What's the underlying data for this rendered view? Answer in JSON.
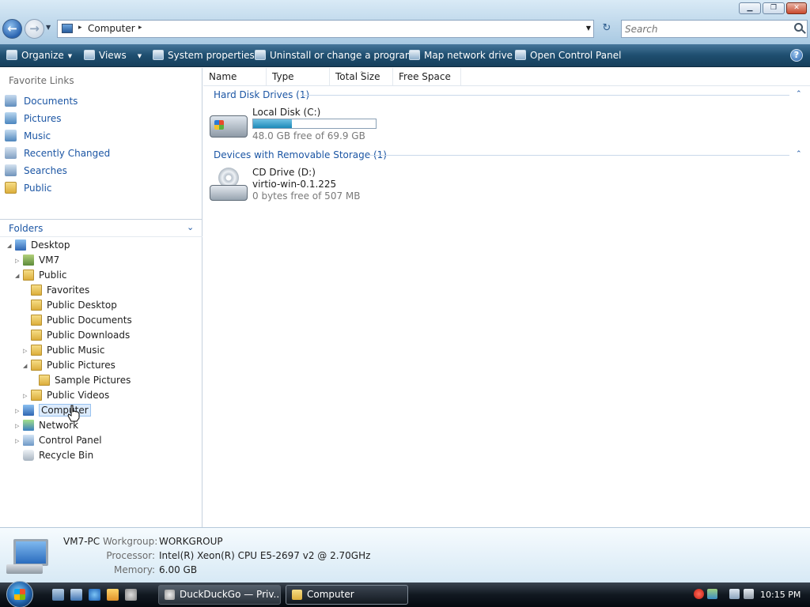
{
  "window": {
    "title": ""
  },
  "titlebar": {
    "min": "▁",
    "max": "❐",
    "close": "✕"
  },
  "address": {
    "location": "Computer",
    "sep1": "▸",
    "sep2": "▸",
    "dropdown": "▼"
  },
  "nav": {
    "back": "←",
    "forward": "→",
    "history": "▼",
    "refresh": "↻"
  },
  "search": {
    "placeholder": "Search"
  },
  "toolbar": {
    "organize": "Organize",
    "views": "Views",
    "system_properties": "System properties",
    "uninstall": "Uninstall or change a program",
    "map_drive": "Map network drive",
    "control_panel": "Open Control Panel",
    "help": "?"
  },
  "sidebar": {
    "favorites_header": "Favorite Links",
    "favorites": [
      "Documents",
      "Pictures",
      "Music",
      "Recently Changed",
      "Searches",
      "Public"
    ],
    "folders_label": "Folders",
    "folders_chevron": "⌄",
    "tree": [
      "Desktop",
      "VM7",
      "Public",
      "Favorites",
      "Public Desktop",
      "Public Documents",
      "Public Downloads",
      "Public Music",
      "Public Pictures",
      "Sample Pictures",
      "Public Videos",
      "Computer",
      "Network",
      "Control Panel",
      "Recycle Bin"
    ]
  },
  "columns": [
    "Name",
    "Type",
    "Total Size",
    "Free Space"
  ],
  "groups": {
    "hard_disk": "Hard Disk Drives (1)",
    "removable": "Devices with Removable Storage (1)",
    "caret": "⌃"
  },
  "drives": {
    "local": {
      "name": "Local Disk (C:)",
      "free": "48.0 GB free of 69.9 GB",
      "used_fraction": 0.313
    },
    "cd": {
      "name": "CD Drive (D:)",
      "label": "virtio-win-0.1.225",
      "free": "0 bytes free of 507 MB"
    }
  },
  "details": {
    "pc_name": "VM7-PC",
    "workgroup_label": "Workgroup:",
    "workgroup": "WORKGROUP",
    "processor_label": "Processor:",
    "processor": "Intel(R) Xeon(R) CPU E5-2697 v2 @ 2.70GHz",
    "memory_label": "Memory:",
    "memory": "6.00 GB"
  },
  "taskbar": {
    "tasks": [
      "DuckDuckGo — Priv...",
      "Computer"
    ],
    "clock": "10:15 PM"
  }
}
